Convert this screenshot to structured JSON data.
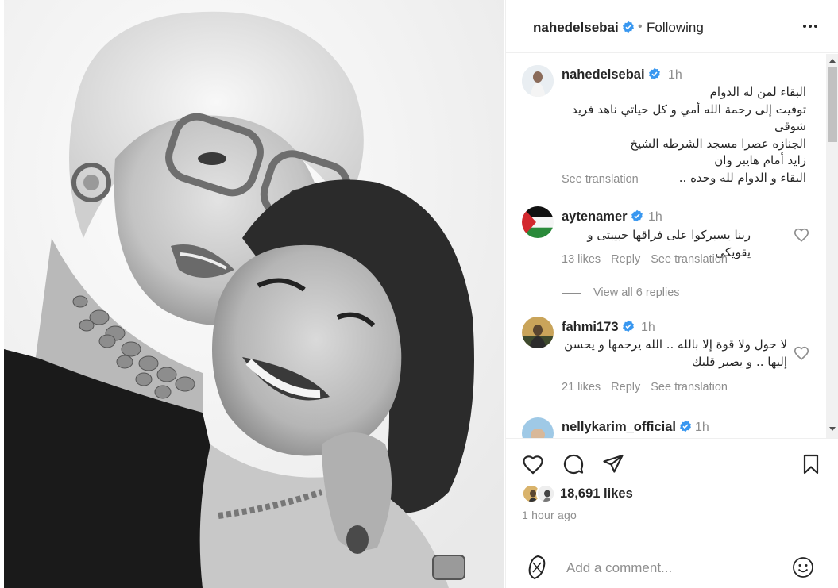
{
  "post": {
    "username": "nahedelsebai",
    "follow_dot": "•",
    "follow_status": "Following"
  },
  "caption": {
    "username": "nahedelsebai",
    "time": "1h",
    "lines": [
      "البقاء لمن له الدوام",
      "توفيت إلى رحمة الله أمي و كل حياتي ناهد فريد شوقى",
      "الجنازه عصرا مسجد الشرطه الشيخ",
      "زايد أمام هايبر وان",
      "البقاء و الدوام لله وحده ..",
      ".."
    ],
    "see_translation": "See translation"
  },
  "comments": [
    {
      "username": "aytenamer",
      "time": "1h",
      "text": "ربنا يسبركوا على فراقها حبيبتى و يقويكى",
      "likes": "13 likes",
      "reply": "Reply",
      "translate": "See translation"
    },
    {
      "username": "fahmi173",
      "time": "1h",
      "text_lines": [
        "لا حول ولا قوة إلا بالله .. الله يرحمها و يحسن",
        "إليها .. و يصبر قلبك"
      ],
      "likes": "21 likes",
      "reply": "Reply",
      "translate": "See translation"
    },
    {
      "username": "nellykarim_official",
      "time": "1h"
    }
  ],
  "view_replies": "View all 6 replies",
  "stats": {
    "likes": "18,691 likes",
    "posted": "1 hour ago"
  },
  "composer": {
    "placeholder": "Add a comment..."
  },
  "icons": {
    "more": "more-options-icon",
    "verified": "verified-badge-icon",
    "like": "heart-icon",
    "comment": "comment-icon",
    "share": "share-icon",
    "save": "bookmark-icon",
    "emoji": "emoji-icon"
  },
  "colors": {
    "verified": "#3897f0",
    "text": "#262626",
    "muted": "#8e8e8e",
    "divider": "#efefef"
  }
}
